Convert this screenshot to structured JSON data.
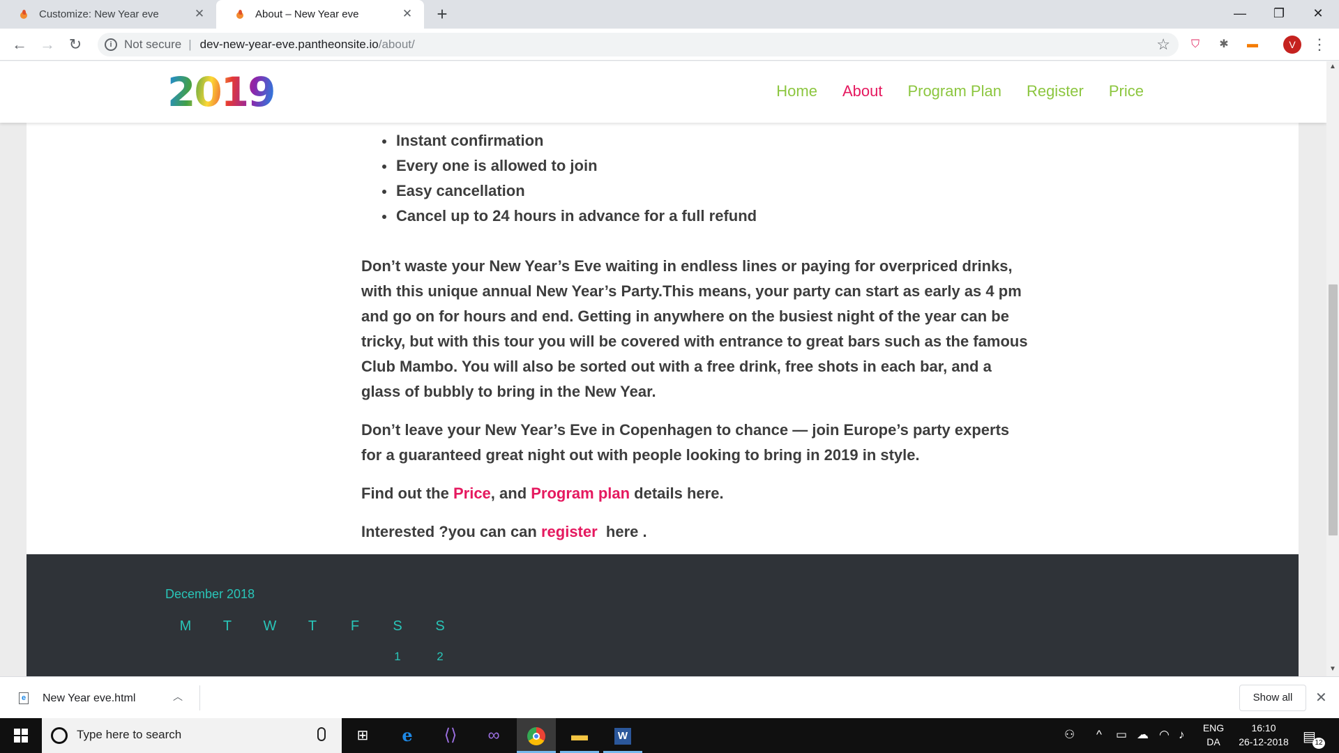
{
  "browser": {
    "tabs": [
      {
        "title": "Customize: New Year eve",
        "active": false
      },
      {
        "title": "About – New Year eve",
        "active": true
      }
    ],
    "security_label": "Not secure",
    "url_host": "dev-new-year-eve.pantheonsite.io",
    "url_path": "/about/",
    "avatar_letter": "V"
  },
  "site": {
    "logo": "2019",
    "nav": [
      {
        "label": "Home",
        "active": false
      },
      {
        "label": "About",
        "active": true
      },
      {
        "label": "Program Plan",
        "active": false
      },
      {
        "label": "Register",
        "active": false
      },
      {
        "label": "Price",
        "active": false
      }
    ],
    "bullets": [
      "Instant confirmation",
      "Every one is allowed to join",
      "Easy cancellation",
      "Cancel up to 24 hours in advance for a full refund"
    ],
    "paragraph1": "Don’t waste your New Year’s Eve waiting in endless lines or paying for overpriced drinks, with this unique annual New Year’s Party.This means, your party can start as early as 4 pm and go on for hours and end. Getting in anywhere on the busiest night of the year can be tricky, but with this tour you will be covered with entrance to great bars such as the famous Club Mambo. You will also be sorted out with a free drink, free shots in each bar, and a glass of bubbly to bring in the New Year.",
    "paragraph2": "Don’t leave your New Year’s Eve in Copenhagen to chance — join Europe’s party experts for a guaranteed great night out with people looking to bring in 2019 in style.",
    "paragraph3": {
      "prefix": "Find out the ",
      "link1": "Price",
      "middle": ", and ",
      "link2": "Program plan",
      "suffix": " details here."
    },
    "paragraph4": {
      "prefix": "Interested ?you can can ",
      "link": "register",
      "suffix": "  here ."
    },
    "calendar": {
      "title": "December 2018",
      "days": [
        "M",
        "T",
        "W",
        "T",
        "F",
        "S",
        "S"
      ],
      "first_row": [
        "",
        "",
        "",
        "",
        "",
        "1",
        "2"
      ]
    },
    "colors": {
      "accent_pink": "#e5195f",
      "nav_green": "#8cc63f",
      "footer_bg": "#2f3338",
      "calendar_teal": "#29c5b8"
    }
  },
  "downloads": {
    "file_name": "New Year eve.html",
    "show_all": "Show all"
  },
  "taskbar": {
    "search_placeholder": "Type here to search",
    "lang_top": "ENG",
    "lang_bottom": "DA",
    "time": "16:10",
    "date": "26-12-2018",
    "notification_count": "12"
  }
}
